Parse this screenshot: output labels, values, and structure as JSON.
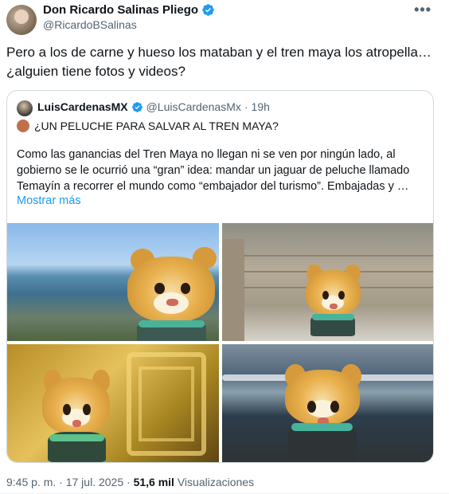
{
  "author": {
    "display_name": "Don Ricardo Salinas Pliego",
    "handle": "@RicardoBSalinas",
    "avatar_icon": "profile-photo",
    "verified_icon": "verified-badge-icon"
  },
  "tweet": {
    "line1": "Pero a los de carne y hueso los mataban y el tren maya los atropella…",
    "line2": "¿alguien tiene fotos y videos?"
  },
  "more_icon": "•••",
  "quote": {
    "display_name": "LuisCardenasMX",
    "handle": "@LuisCardenasMx",
    "separator": "·",
    "time": "19h",
    "title": "¿UN PELUCHE PARA SALVAR AL TREN MAYA?",
    "body_line1": "Como las ganancias del Tren Maya no llegan ni se ven por ningún lado, al",
    "body_line2": "gobierno se le ocurrió una “gran” idea: mandar un jaguar de peluche llamado",
    "body_line3": "Temayín a recorrer el mundo como “embajador del turismo”. Embajadas y …",
    "show_more": "Mostrar más"
  },
  "footer": {
    "time": "9:45 p. m.",
    "sep1": "·",
    "date": "17 jul. 2025",
    "sep2": "·",
    "views_count": "51,6 mil",
    "views_label": "Visualizaciones"
  },
  "colors": {
    "accent": "#1d9bf0",
    "text": "#0f1419",
    "secondary": "#536471",
    "border": "#cfd9de"
  }
}
